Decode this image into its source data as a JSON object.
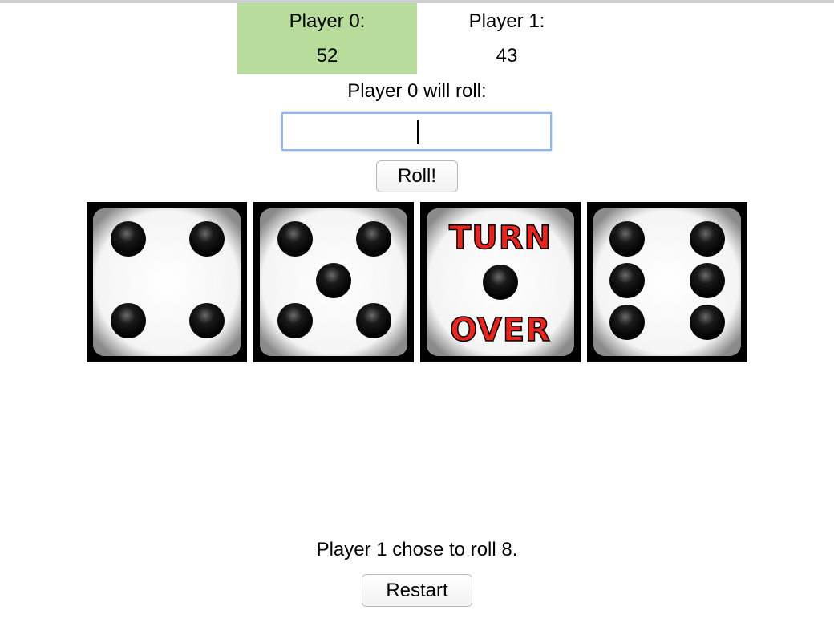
{
  "scoreboard": {
    "players": [
      {
        "label": "Player 0:",
        "score": "52",
        "active": true
      },
      {
        "label": "Player 1:",
        "score": "43",
        "active": false
      }
    ],
    "active_color": "#b7dc9c"
  },
  "turn_prompt": "Player 0 will roll:",
  "roll_input": {
    "value": "",
    "placeholder": ""
  },
  "roll_button_label": "Roll!",
  "dice": [
    {
      "face": 4,
      "label": "four-pips"
    },
    {
      "face": 5,
      "label": "five-pips"
    },
    {
      "face": 1,
      "label": "turn-over",
      "text_top": "TURN",
      "text_bottom": "OVER",
      "text_color": "#e8261f"
    },
    {
      "face": 6,
      "label": "six-pips"
    }
  ],
  "status_message": "Player 1 chose to roll 8.",
  "restart_button_label": "Restart"
}
